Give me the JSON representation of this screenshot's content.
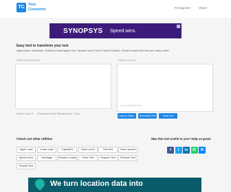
{
  "header": {
    "logo_letters": "TC",
    "logo_line1": "Text",
    "logo_line2": "Converter",
    "nav_lang": "Portuguese",
    "nav_extra": "Views"
  },
  "ad_top": {
    "brand": "SYNOPSYS",
    "tagline": "Speed wins."
  },
  "intro": {
    "title": "Easy tool to transform your text",
    "subtitle": "Uppercase, lowercase, Random lower/upper text, Speech word Count, Word Counter, Extract email from text and many more."
  },
  "input_panel": {
    "label": "Paste your text below"
  },
  "output_panel": {
    "label": "Watch your text",
    "placeholder": "Your converted text"
  },
  "stats": [
    {
      "label": "Words Count: 0"
    },
    {
      "label": "Characters Count: 0"
    },
    {
      "label": "Reading time: 0 sec"
    }
  ],
  "actions": [
    {
      "label": "Copy to Clipb..."
    },
    {
      "label": "Download Text"
    },
    {
      "label": "Clear text"
    }
  ],
  "utilities": {
    "title": "Check out other utilities",
    "items": [
      "Upper case",
      "Lower case",
      "CapitaliZe",
      "Word count",
      "Trim text",
      "Clean spaces",
      "Speech time",
      "Hashtags",
      "Extract e-mails",
      "Order Text",
      "Replace Text",
      "Random Text",
      "Repeat Text"
    ]
  },
  "share": {
    "title": "Was this tool useful to you? Help us grow!",
    "icons": [
      {
        "name": "facebook-icon",
        "glyph": "f",
        "color": "#3b5998"
      },
      {
        "name": "twitter-icon",
        "glyph": "t",
        "color": "#1da1f2"
      },
      {
        "name": "linkedin-icon",
        "glyph": "in",
        "color": "#0077b5"
      },
      {
        "name": "whatsapp-icon",
        "glyph": "✆",
        "color": "#25d366"
      },
      {
        "name": "messenger-icon",
        "glyph": "✉",
        "color": "#0084ff"
      }
    ]
  },
  "ad_bottom": {
    "text": "We turn location data into"
  }
}
